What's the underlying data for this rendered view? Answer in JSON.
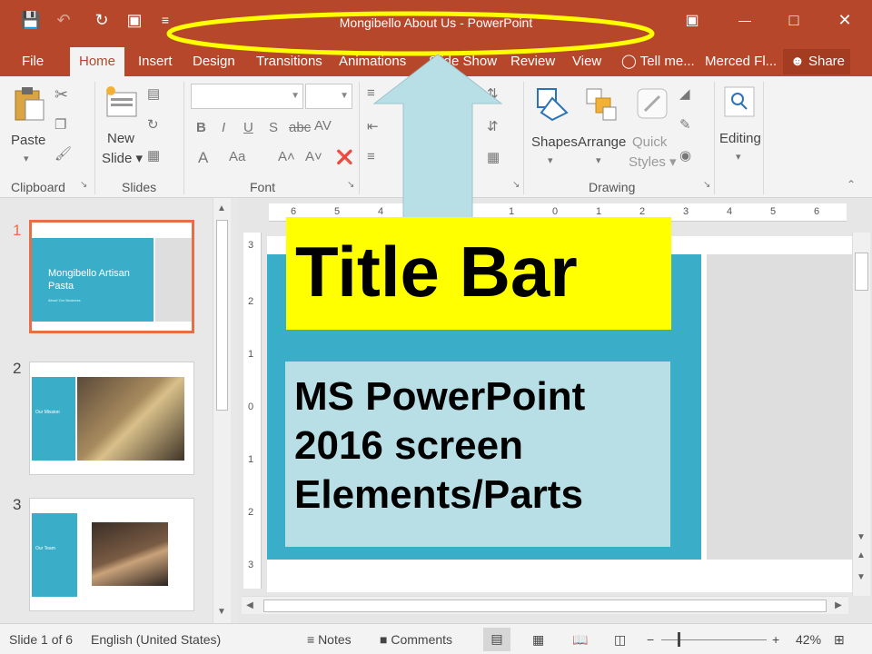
{
  "window": {
    "title": "Mongibello About Us - PowerPoint",
    "accent": "#b7472a"
  },
  "qat": {
    "save_icon": "💾",
    "undo_icon": "↶",
    "redo_icon": "↻",
    "present_icon": "▣",
    "customize_icon": "≡"
  },
  "window_controls": {
    "ribbon_display_icon": "▣",
    "minimize_icon": "—",
    "maximize_icon": "□",
    "close_icon": "✕"
  },
  "tabs": {
    "file": "File",
    "home": "Home",
    "insert": "Insert",
    "design": "Design",
    "transitions": "Transitions",
    "animations": "Animations",
    "slideshow": "Slide Show",
    "review": "Review",
    "view": "View",
    "tell_me": "Tell me...",
    "user": "Merced Fl...",
    "share": "Share"
  },
  "ribbon": {
    "paste": "Paste",
    "new_slide_1": "New",
    "new_slide_2": "Slide ▾",
    "shapes": "Shapes",
    "arrange": "Arrange",
    "quick_styles_1": "Quick",
    "quick_styles_2": "Styles ▾",
    "editing": "Editing",
    "groups": {
      "clipboard": "Clipboard",
      "slides": "Slides",
      "font": "Font",
      "drawing": "Drawing"
    },
    "font_buttons": {
      "bold": "B",
      "italic": "I",
      "underline": "U",
      "shadow": "S",
      "strike": "abc",
      "spacing": "AV",
      "font_color": "A",
      "change_case": "Aa",
      "grow": "A˄",
      "shrink": "A˅"
    }
  },
  "thumbnails": [
    {
      "number": "1",
      "title": "Mongibello Artisan Pasta",
      "subtitle": "About Our Business"
    },
    {
      "number": "2",
      "title": "Our Mission"
    },
    {
      "number": "3",
      "title": "Our Team"
    }
  ],
  "ruler": {
    "h_labels": [
      "6",
      "5",
      "4",
      "1",
      "0",
      "1",
      "2",
      "3",
      "4",
      "5",
      "6"
    ],
    "v_labels": [
      "3",
      "2",
      "1",
      "0",
      "1",
      "2",
      "3"
    ]
  },
  "annotation": {
    "title": "Title Bar",
    "description": "MS PowerPoint 2016 screen Elements/Parts",
    "highlight_color": "#ffff00",
    "box_color": "#b9dfe6"
  },
  "status": {
    "slide": "Slide 1 of 6",
    "language": "English (United States)",
    "notes": "Notes",
    "comments": "Comments",
    "zoom_minus": "−",
    "zoom_plus": "+",
    "zoom": "42%"
  }
}
